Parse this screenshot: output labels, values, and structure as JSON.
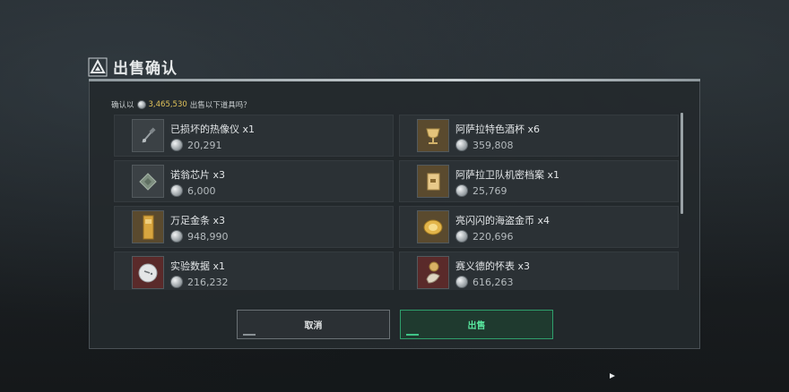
{
  "dialog": {
    "title": "出售确认",
    "confirm_prefix": "确认以",
    "confirm_amount": "3,465,530",
    "confirm_suffix": "出售以下道具吗？"
  },
  "items": [
    {
      "name": "已损坏的热像仪 x1",
      "price": "20,291",
      "icon": "thermal-imager-icon"
    },
    {
      "name": "阿萨拉特色酒杯 x6",
      "price": "359,808",
      "icon": "goblet-icon"
    },
    {
      "name": "诺翁芯片 x3",
      "price": "6,000",
      "icon": "chip-icon"
    },
    {
      "name": "阿萨拉卫队机密档案 x1",
      "price": "25,769",
      "icon": "dossier-icon"
    },
    {
      "name": "万足金条 x3",
      "price": "948,990",
      "icon": "gold-bar-icon"
    },
    {
      "name": "亮闪闪的海盗金币 x4",
      "price": "220,696",
      "icon": "gold-coin-icon"
    },
    {
      "name": "实验数据 x1",
      "price": "216,232",
      "icon": "data-disc-icon"
    },
    {
      "name": "赛义德的怀表 x3",
      "price": "616,263",
      "icon": "pocket-watch-icon"
    }
  ],
  "buttons": {
    "cancel": "取消",
    "sell": "出售"
  },
  "colors": {
    "currency_amount": "#e0c25a",
    "sell_accent": "#57e39c"
  }
}
